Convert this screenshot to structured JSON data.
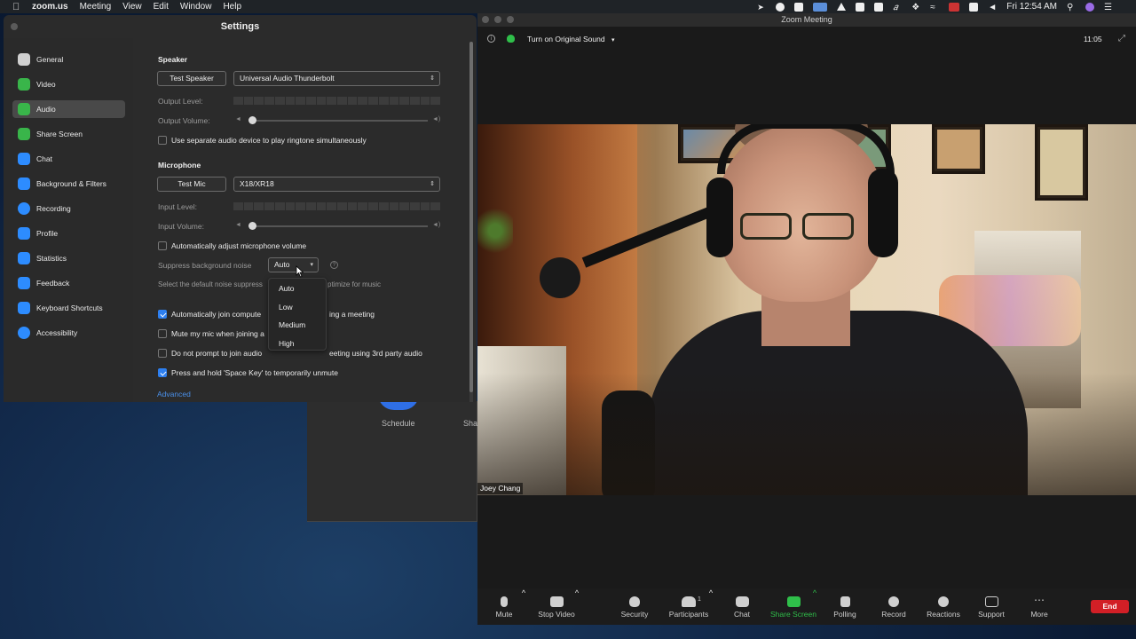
{
  "menubar": {
    "app": "zoom.us",
    "items": [
      "Meeting",
      "View",
      "Edit",
      "Window",
      "Help"
    ],
    "clock": "Fri 12:54 AM"
  },
  "home_fragment": {
    "schedule_label": "Schedule",
    "share_label": "Share"
  },
  "settings": {
    "title": "Settings",
    "sidebar": [
      {
        "label": "General",
        "color": "#d0d0d0"
      },
      {
        "label": "Video",
        "color": "#39b54a"
      },
      {
        "label": "Audio",
        "color": "#39b54a"
      },
      {
        "label": "Share Screen",
        "color": "#39b54a"
      },
      {
        "label": "Chat",
        "color": "#2d8cff"
      },
      {
        "label": "Background & Filters",
        "color": "#2d8cff"
      },
      {
        "label": "Recording",
        "color": "#2d8cff"
      },
      {
        "label": "Profile",
        "color": "#2d8cff"
      },
      {
        "label": "Statistics",
        "color": "#2d8cff"
      },
      {
        "label": "Feedback",
        "color": "#2d8cff"
      },
      {
        "label": "Keyboard Shortcuts",
        "color": "#2d8cff"
      },
      {
        "label": "Accessibility",
        "color": "#2d8cff"
      }
    ],
    "active_item": "Audio",
    "speaker": {
      "section": "Speaker",
      "test_button": "Test Speaker",
      "device": "Universal Audio Thunderbolt",
      "output_level_label": "Output Level:",
      "output_volume_label": "Output Volume:",
      "output_volume": 0.0
    },
    "ringtone_option": {
      "label": "Use separate audio device to play ringtone simultaneously",
      "checked": false
    },
    "microphone": {
      "section": "Microphone",
      "test_button": "Test Mic",
      "device": "X18/XR18",
      "input_level_label": "Input Level:",
      "input_volume_label": "Input Volume:",
      "input_volume": 0.0
    },
    "auto_adjust": {
      "label": "Automatically adjust microphone volume",
      "checked": false
    },
    "suppress": {
      "label": "Suppress background noise",
      "value": "Auto",
      "hint": "Select the default noise suppress",
      "hint_tail": "ptimize for music",
      "options": [
        "Auto",
        "Low",
        "Medium",
        "High"
      ]
    },
    "options": [
      {
        "label_a": "Automatically join compute",
        "label_b": "ing a meeting",
        "checked": true
      },
      {
        "label_a": "Mute my mic when joining a",
        "label_b": "",
        "checked": false
      },
      {
        "label_a": "Do not prompt to join audio",
        "label_b": "eeting using 3rd party audio",
        "checked": false
      },
      {
        "label_a": "Press and hold 'Space Key' to temporarily unmute",
        "label_b": "",
        "checked": true
      }
    ],
    "advanced_link": "Advanced"
  },
  "meeting": {
    "title": "Zoom Meeting",
    "original_sound": "Turn on Original Sound",
    "timer": "11:05",
    "participant_name": "Joey Chang",
    "participant_count": "1",
    "toolbar": [
      {
        "label": "Mute",
        "icon": "microphone-icon"
      },
      {
        "label": "Stop Video",
        "icon": "video-camera-icon"
      },
      {
        "label": "Security",
        "icon": "shield-icon"
      },
      {
        "label": "Participants",
        "icon": "participants-icon"
      },
      {
        "label": "Chat",
        "icon": "chat-icon"
      },
      {
        "label": "Share Screen",
        "icon": "share-screen-icon"
      },
      {
        "label": "Polling",
        "icon": "polling-icon"
      },
      {
        "label": "Record",
        "icon": "record-icon"
      },
      {
        "label": "Reactions",
        "icon": "reactions-icon"
      },
      {
        "label": "Support",
        "icon": "support-icon"
      },
      {
        "label": "More",
        "icon": "more-icon"
      }
    ],
    "end_label": "End",
    "accent_green": "#2fbf4a",
    "end_red": "#d21f26"
  }
}
